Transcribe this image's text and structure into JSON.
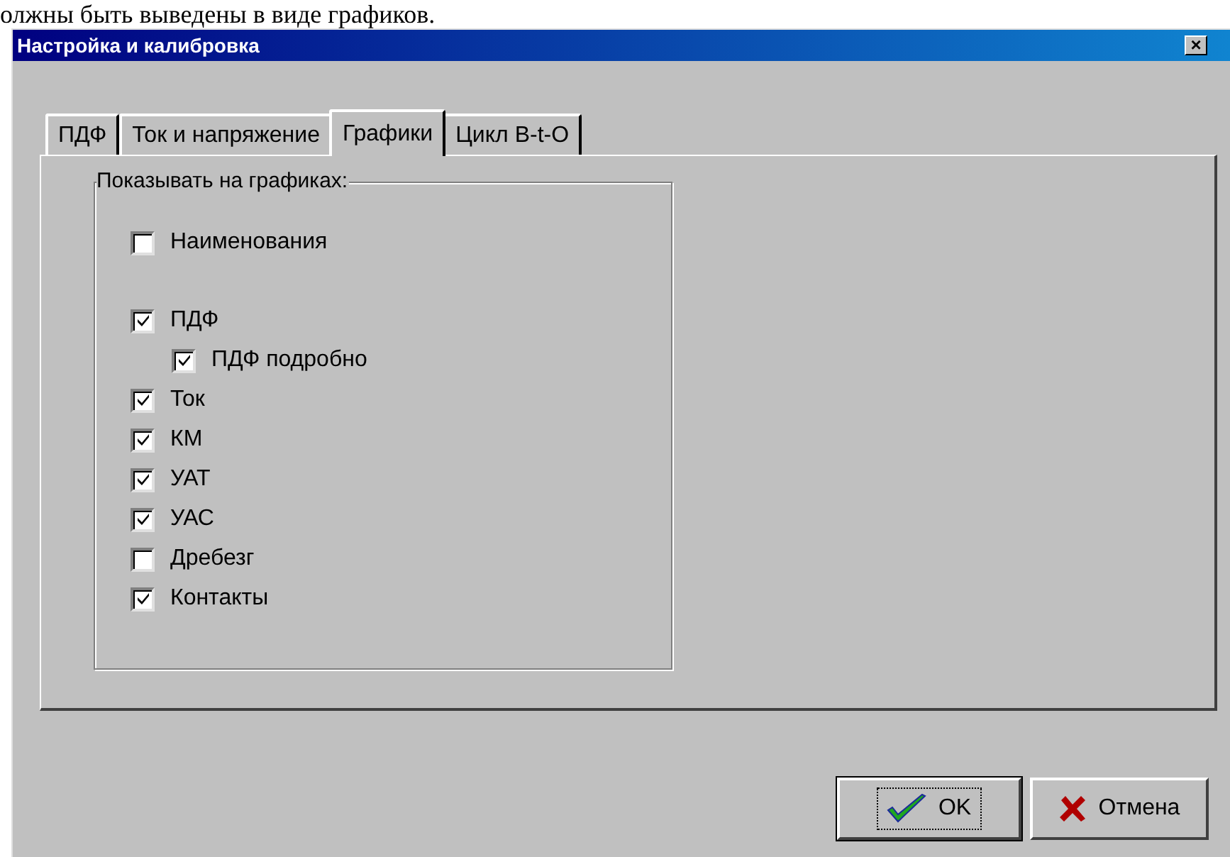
{
  "background_text": "олжны быть выведены в виде графиков.",
  "window": {
    "title": "Настройка и калибровка",
    "close": "×"
  },
  "tabs": [
    {
      "label": "ПДФ",
      "selected": false
    },
    {
      "label": "Ток и напряжение",
      "selected": false
    },
    {
      "label": "Графики",
      "selected": true
    },
    {
      "label": "Цикл В-t-О",
      "selected": false
    }
  ],
  "group": {
    "title": "Показывать на графиках:",
    "sections": [
      [
        {
          "label": "Наименования",
          "checked": false
        }
      ],
      [
        {
          "label": "ПДФ",
          "checked": true,
          "children": [
            {
              "label": "ПДФ подробно",
              "checked": true
            }
          ]
        },
        {
          "label": "Ток",
          "checked": true
        },
        {
          "label": "КМ",
          "checked": true
        },
        {
          "label": "УАТ",
          "checked": true
        },
        {
          "label": "УАС",
          "checked": true
        },
        {
          "label": "Дребезг",
          "checked": false
        },
        {
          "label": "Контакты",
          "checked": true
        }
      ]
    ]
  },
  "buttons": [
    {
      "label": "OK",
      "kind": "ok",
      "focused": true
    },
    {
      "label": "Отмена",
      "kind": "cancel",
      "focused": false
    }
  ]
}
